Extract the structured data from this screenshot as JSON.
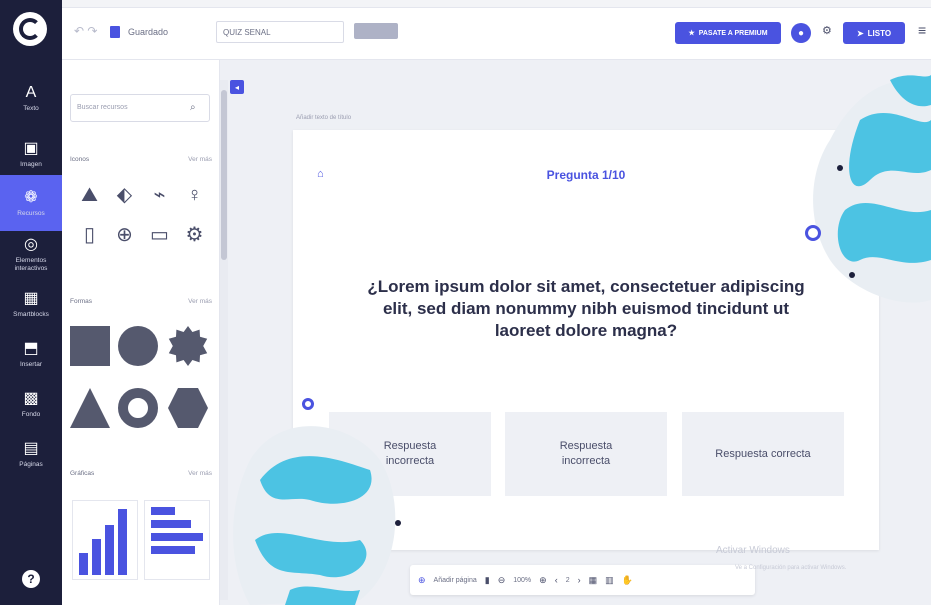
{
  "toolbar": {
    "saved_label": "Guardado",
    "title_value": "QUIZ SENAL",
    "tag_label": "",
    "premium_label": "PASATE A PREMIUM",
    "listo_label": "LISTO"
  },
  "rail": {
    "items": [
      {
        "icon": "A",
        "label": "Texto"
      },
      {
        "icon": "▣",
        "label": "Imagen"
      },
      {
        "icon": "❁",
        "label": "Recursos"
      },
      {
        "icon": "◎",
        "label": "Elementos interactivos"
      },
      {
        "icon": "▦",
        "label": "Smartblocks"
      },
      {
        "icon": "⬒",
        "label": "Insertar"
      },
      {
        "icon": "▩",
        "label": "Fondo"
      },
      {
        "icon": "▤",
        "label": "Páginas"
      }
    ]
  },
  "panel": {
    "search_placeholder": "Buscar recursos",
    "sections": [
      {
        "title": "Iconos",
        "more": "Ver más"
      },
      {
        "title": "Formas",
        "more": "Ver más"
      },
      {
        "title": "Gráficas",
        "more": "Ver más"
      }
    ],
    "icon_glyphs": [
      "⛰",
      "⬖",
      "⌁",
      "♀",
      "▯",
      "⊕",
      "▭",
      "⚙"
    ]
  },
  "canvas": {
    "breadcrumb": "Añadir texto de título",
    "counter": "Pregunta 1/10",
    "question": "¿Lorem ipsum dolor sit amet, consectetuer adipiscing elit, sed diam nonummy nibh euismod tincidunt ut laoreet dolore magna?",
    "answers": [
      "Respuesta incorrecta",
      "Respuesta incorrecta",
      "Respuesta correcta"
    ]
  },
  "bottombar": {
    "add_page": "Añadir página",
    "zoom": "100%",
    "page": "2"
  },
  "watermark": {
    "line1": "Activar Windows",
    "line2": "Ve a Configuración para activar Windows."
  },
  "colors": {
    "accent": "#4a53e0",
    "rail": "#1c1f3b",
    "deco_cyan": "#4cc3e3"
  }
}
